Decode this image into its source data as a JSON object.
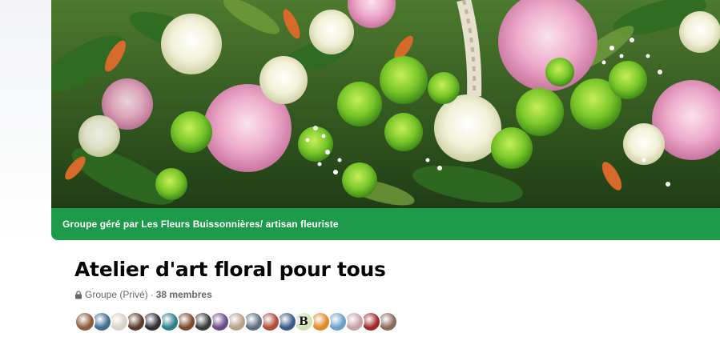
{
  "cover": {
    "managed_by": "Groupe géré par Les Fleurs Buissonnières/ artisan fleuriste"
  },
  "group": {
    "title": "Atelier d'art floral pour tous",
    "privacy": "Groupe (Privé)",
    "separator": "·",
    "members": "38 membres"
  },
  "icons": {
    "privacy": "lock-icon"
  },
  "colors": {
    "managed_bar": "#1e9a4b",
    "title": "#050505",
    "meta": "#65676b"
  },
  "member_avatars": [
    {
      "color": "#8b5a3c"
    },
    {
      "color": "#3f6e8f"
    },
    {
      "color": "#d9d2c4"
    },
    {
      "color": "#5a3b2a"
    },
    {
      "color": "#2f2f35"
    },
    {
      "color": "#2a7f8a"
    },
    {
      "color": "#7a4b2a"
    },
    {
      "color": "#3a3a3a"
    },
    {
      "color": "#6c4a8a"
    },
    {
      "color": "#b9a08a"
    },
    {
      "color": "#5e6f80"
    },
    {
      "color": "#b04a3a"
    },
    {
      "color": "#3a5a8a"
    },
    {
      "color": "#cfe3b0",
      "letter": "B"
    },
    {
      "color": "#e08a2a"
    },
    {
      "color": "#6aa0c8"
    },
    {
      "color": "#c8a0a8"
    },
    {
      "color": "#a02a2a"
    },
    {
      "color": "#8a6a5a"
    }
  ]
}
